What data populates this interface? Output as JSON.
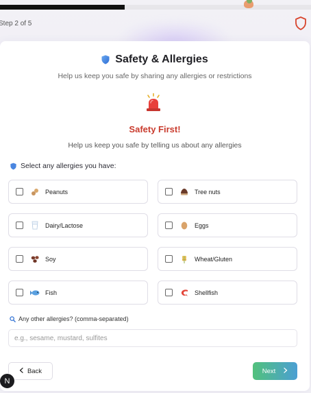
{
  "progress": {
    "step_text": "Step 2 of 5",
    "fraction": 0.4
  },
  "header": {
    "title": "Safety & Allergies",
    "subtitle": "Help us keep you safe by sharing any allergies or restrictions"
  },
  "safety": {
    "title": "Safety First!",
    "description": "Help us keep you safe by telling us about any allergies"
  },
  "allergy_prompt": "Select any allergies you have:",
  "allergies": [
    {
      "label": "Peanuts",
      "icon": "peanut-icon",
      "checked": false
    },
    {
      "label": "Tree nuts",
      "icon": "chestnut-icon",
      "checked": false
    },
    {
      "label": "Dairy/Lactose",
      "icon": "milk-glass-icon",
      "checked": false
    },
    {
      "label": "Eggs",
      "icon": "egg-icon",
      "checked": false
    },
    {
      "label": "Soy",
      "icon": "soybean-icon",
      "checked": false
    },
    {
      "label": "Wheat/Gluten",
      "icon": "wheat-icon",
      "checked": false
    },
    {
      "label": "Fish",
      "icon": "fish-icon",
      "checked": false
    },
    {
      "label": "Shellfish",
      "icon": "shrimp-icon",
      "checked": false
    }
  ],
  "other": {
    "label": "Any other allergies? (comma-separated)",
    "placeholder": "e.g., sesame, mustard, sulfites",
    "value": ""
  },
  "nav": {
    "back_label": "Back",
    "next_label": "Next"
  },
  "badge": {
    "letter": "N"
  },
  "colors": {
    "accent_red": "#c93b2d",
    "next_gradient_start": "#52c17c",
    "next_gradient_end": "#4b9fd3",
    "progress_fill": "#111111"
  }
}
